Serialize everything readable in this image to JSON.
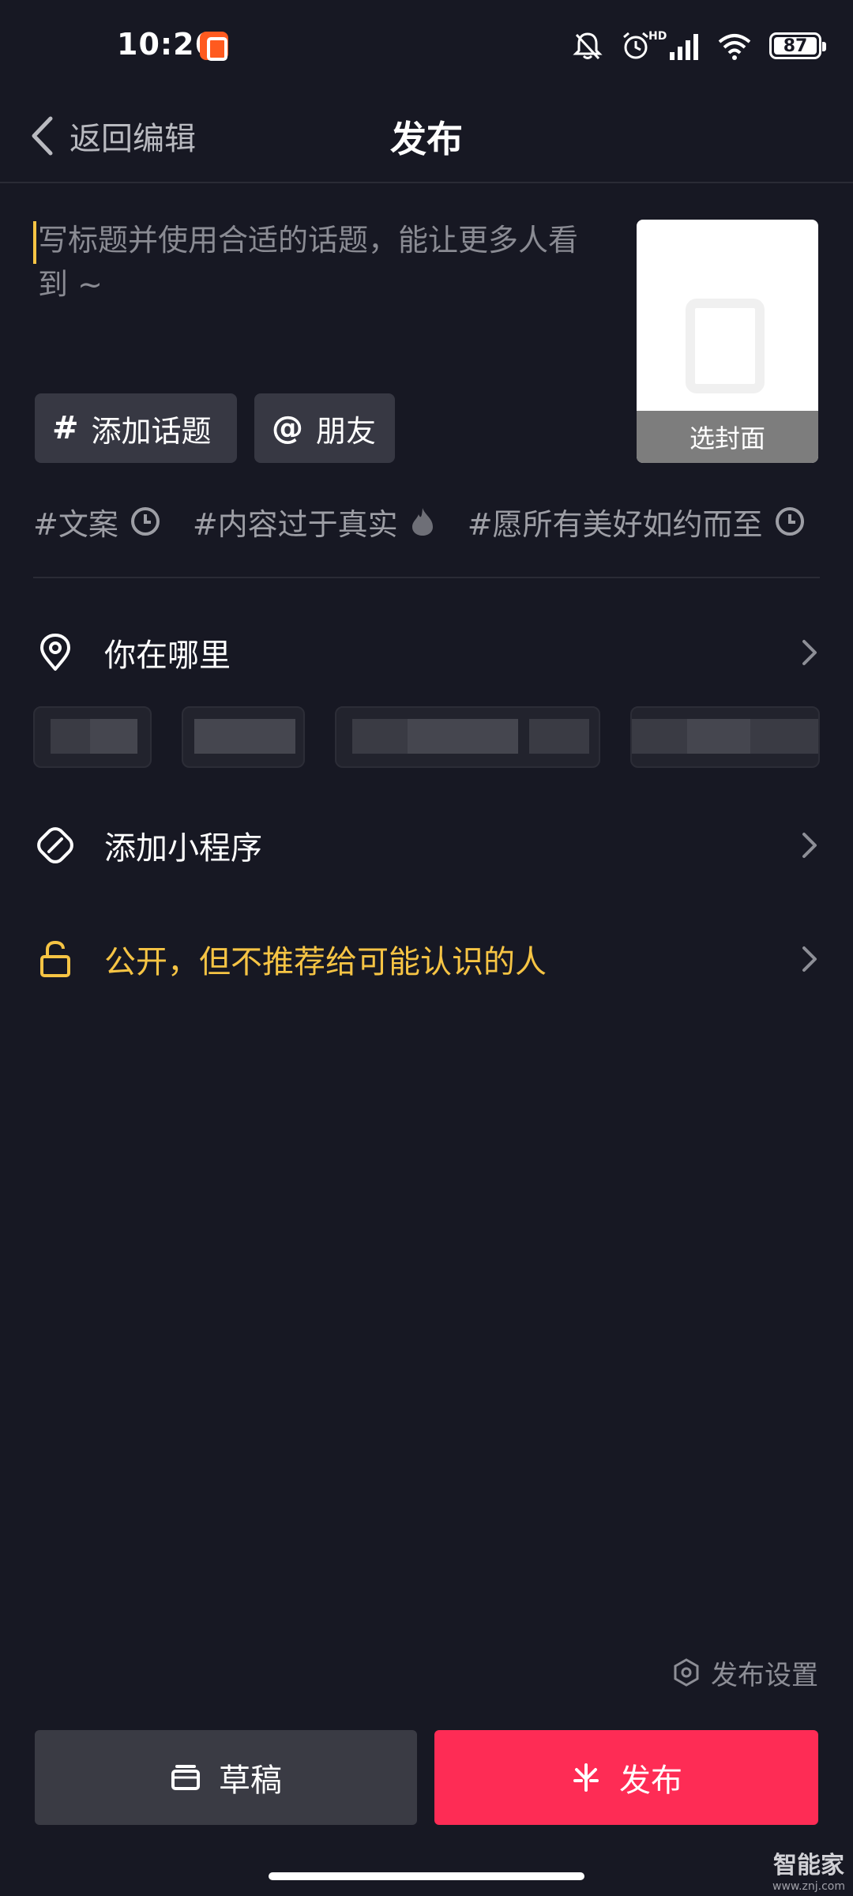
{
  "status_bar": {
    "time": "10:26",
    "network": "HD",
    "battery": "87",
    "battery_level": 0.87
  },
  "nav": {
    "back_label": "返回编辑",
    "title": "发布"
  },
  "caption": {
    "placeholder": "写标题并使用合适的话题，能让更多人看到 ~"
  },
  "cover": {
    "button_label": "选封面"
  },
  "chips": {
    "topic_icon": "#",
    "topic_label": "添加话题",
    "friend_icon": "@",
    "friend_label": "朋友"
  },
  "suggested_topics": [
    {
      "text": "#文案",
      "icon": "clock-icon"
    },
    {
      "text": "#内容过于真实",
      "icon": "fire-icon"
    },
    {
      "text": "#愿所有美好如约而至",
      "icon": "clock-icon"
    }
  ],
  "rows": {
    "location_label": "你在哪里",
    "mini_program_label": "添加小程序",
    "privacy_label": "公开，但不推荐给可能认识的人"
  },
  "publish_settings": {
    "label": "发布设置"
  },
  "actions": {
    "draft_label": "草稿",
    "publish_label": "发布"
  },
  "watermark": {
    "main": "智能家",
    "sub": "www.znj.com"
  },
  "colors": {
    "background": "#171823",
    "accent_yellow": "#f6c444",
    "publish_red": "#fe2c55",
    "chip_bg": "#373843"
  }
}
